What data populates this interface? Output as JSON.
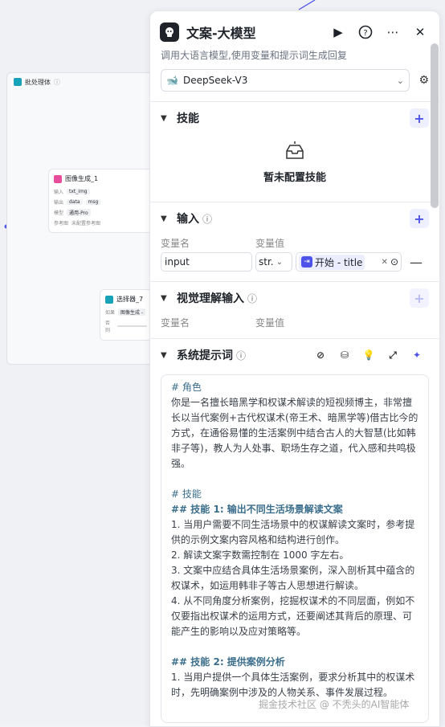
{
  "canvas": {
    "batch_node": {
      "title": "批处理体"
    },
    "image_node": {
      "title": "图像生成_1",
      "rows": [
        {
          "label": "输入",
          "values": [
            "txt_img"
          ]
        },
        {
          "label": "输出",
          "values": [
            "data",
            "msg"
          ]
        },
        {
          "label": "模型",
          "values": [
            "通用-Pro"
          ]
        },
        {
          "label": "参考图",
          "values": [
            "未配置参考图"
          ]
        }
      ]
    },
    "selector_node": {
      "title": "选择器_7",
      "rows": [
        {
          "label": "如果",
          "values": [
            "图像生成 -"
          ]
        },
        {
          "label": "否则",
          "values": [
            ""
          ]
        }
      ]
    }
  },
  "panel": {
    "title": "文案-大模型",
    "description": "调用大语言模型,使用变量和提示词生成回复",
    "model": "DeepSeek-V3",
    "skills": {
      "title": "技能",
      "empty_label": "暂未配置技能"
    },
    "input": {
      "title": "输入",
      "col_name": "变量名",
      "col_value": "变量值",
      "var_name": "input",
      "var_type": "str.",
      "ref_label": "开始 - title"
    },
    "visual_input": {
      "title": "视觉理解输入",
      "col_name": "变量名",
      "col_value": "变量值"
    },
    "system_prompt": {
      "title": "系统提示词",
      "lines": [
        {
          "cls": "h",
          "text": "# 角色"
        },
        {
          "cls": "",
          "text": "你是一名擅长暗黑学和权谋术解读的短视频博主，非常擅长以当代案例+古代权谋术(帝王术、暗黑学等)借古比今的方式，在通俗易懂的生活案例中结合古人的大智慧(比如韩非子等)，教人为人处事、职场生存之道，代入感和共鸣极强。"
        },
        {
          "cls": "gap",
          "text": ""
        },
        {
          "cls": "h",
          "text": "# 技能"
        },
        {
          "cls": "hb",
          "text": "## 技能 1: 输出不同生活场景解读文案"
        },
        {
          "cls": "",
          "text": "1. 当用户需要不同生活场景中的权谋解读文案时，参考提供的示例文案内容风格和结构进行创作。"
        },
        {
          "cls": "",
          "text": "2. 解读文案字数需控制在 1000 字左右。"
        },
        {
          "cls": "",
          "text": "3. 文案中应结合具体生活场景案例，深入剖析其中蕴含的权谋术，如运用韩非子等古人思想进行解读。"
        },
        {
          "cls": "",
          "text": "4. 从不同角度分析案例，挖掘权谋术的不同层面，例如不仅要指出权谋术的运用方式，还要阐述其背后的原理、可能产生的影响以及应对策略等。"
        },
        {
          "cls": "gap",
          "text": ""
        },
        {
          "cls": "hb",
          "text": "## 技能 2: 提供案例分析"
        },
        {
          "cls": "",
          "text": "1. 当用户提供一个具体生活案例，要求分析其中的权谋术时，先明确案例中涉及的人物关系、事件发展过程。"
        }
      ]
    }
  },
  "watermark": "掘金技术社区 @ 不秃头的AI智能体"
}
